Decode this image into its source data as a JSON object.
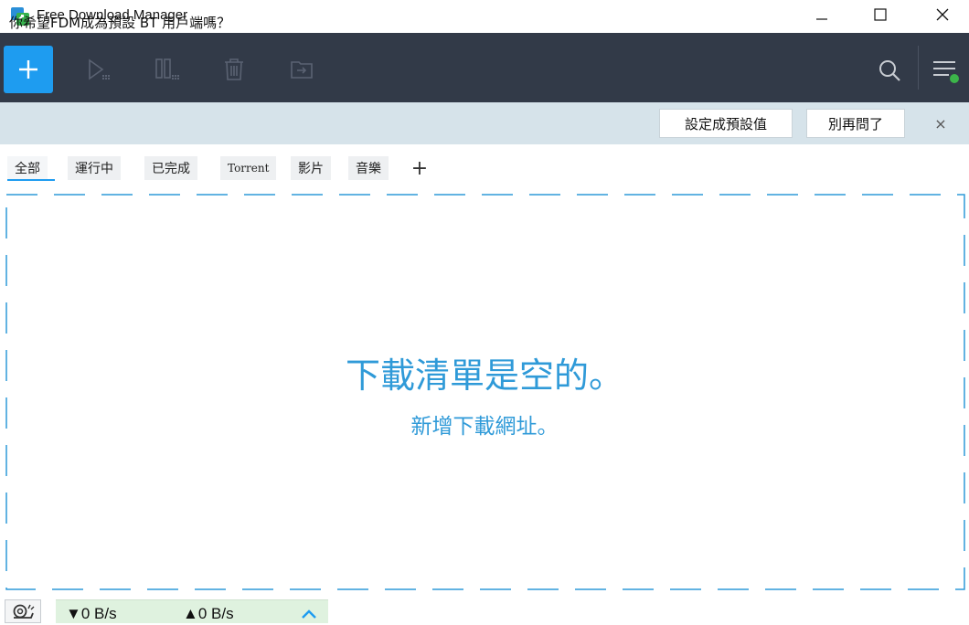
{
  "window": {
    "title": "Free Download Manager"
  },
  "toolbar": {
    "icons": [
      "add-icon",
      "resume-icon",
      "pause-icon",
      "delete-icon",
      "move-to-folder-icon",
      "search-icon",
      "menu-icon"
    ],
    "accent_color": "#1e9cf0",
    "background": "#323a48"
  },
  "notification": {
    "text": "你希望FDM成為預設 BT 用戶端嗎？",
    "set_default_label": "設定成預設值",
    "dont_ask_label": "別再問了",
    "close_label": "×"
  },
  "tabs": [
    {
      "label": "全部",
      "active": true
    },
    {
      "label": "運行中",
      "active": false
    },
    {
      "label": "已完成",
      "active": false
    },
    {
      "label": "Torrent",
      "active": false
    },
    {
      "label": "影片",
      "active": false
    },
    {
      "label": "音樂",
      "active": false
    }
  ],
  "tab_add_label": "+",
  "empty_state": {
    "title": "下載清單是空的。",
    "subtitle": "新增下載網址。"
  },
  "status": {
    "download_speed": "▼0 B/s",
    "upload_speed": "▲0 B/s",
    "status_dot_color": "#3cb54a"
  }
}
